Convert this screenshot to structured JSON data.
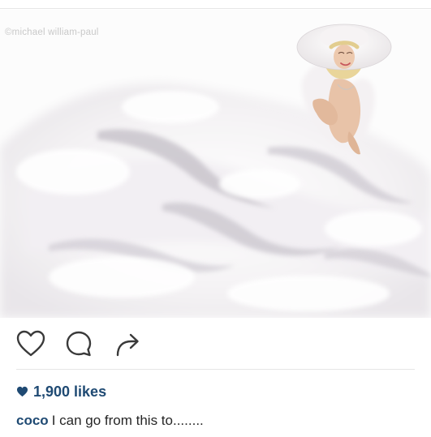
{
  "post": {
    "watermark": "©michael william-paul",
    "likes_text": "1,900 likes",
    "caption": {
      "username": "coco",
      "text": "I can go from this to........"
    }
  },
  "icons": {
    "like": "heart-outline-icon",
    "comment": "comment-bubble-icon",
    "share": "share-arrow-icon",
    "likes": "heart-filled-icon"
  },
  "colors": {
    "link": "#1f4a73",
    "icon": "#3a3a3a",
    "divider": "#e6e6e6",
    "photo_background": "#fbfbfb"
  }
}
